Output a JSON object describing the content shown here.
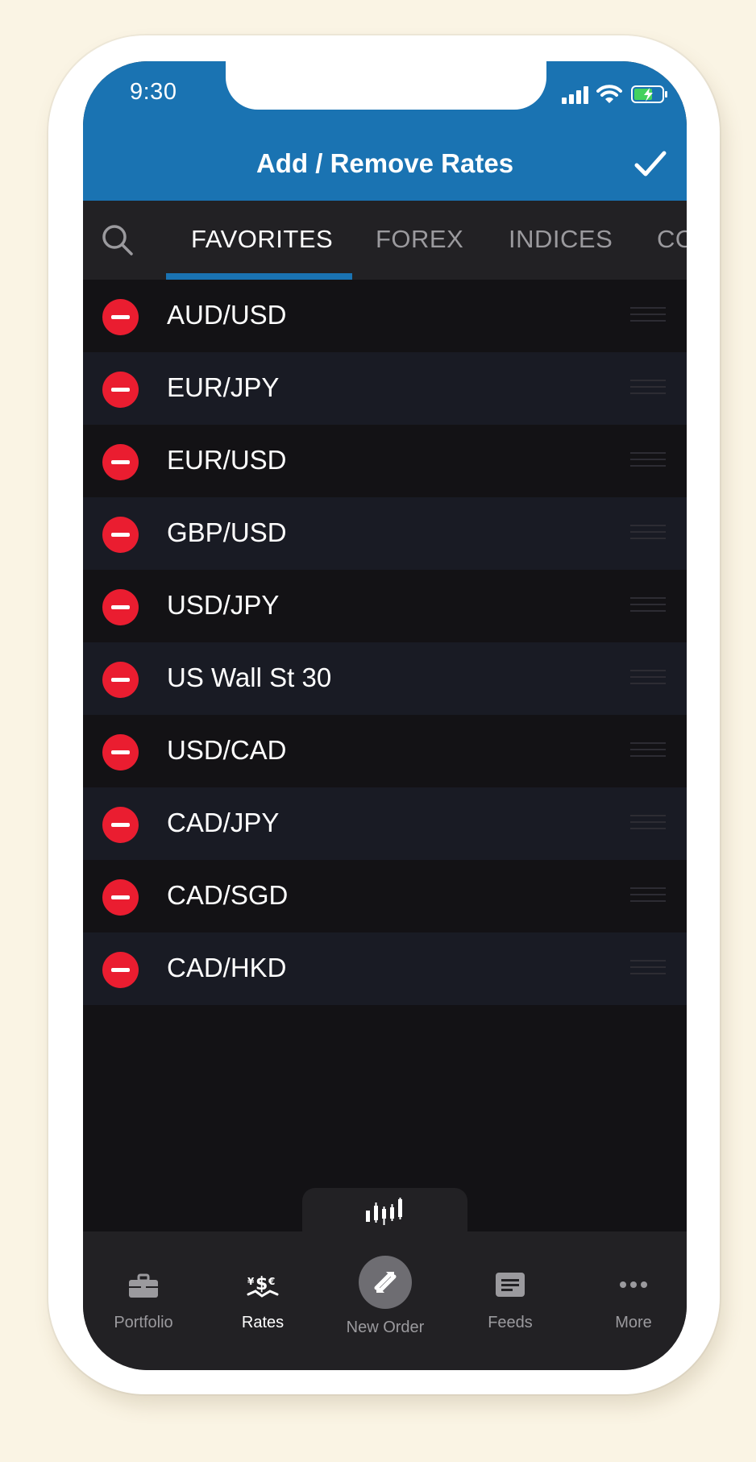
{
  "status_bar": {
    "time": "9:30"
  },
  "header": {
    "title": "Add / Remove Rates"
  },
  "tabs": [
    {
      "label": "FAVORITES",
      "active": true
    },
    {
      "label": "FOREX",
      "active": false
    },
    {
      "label": "INDICES",
      "active": false
    },
    {
      "label": "CO",
      "active": false
    }
  ],
  "rates": [
    "AUD/USD",
    "EUR/JPY",
    "EUR/USD",
    "GBP/USD",
    "USD/JPY",
    "US Wall St 30",
    "USD/CAD",
    "CAD/JPY",
    "CAD/SGD",
    "CAD/HKD"
  ],
  "bottom_nav": {
    "portfolio": "Portfolio",
    "rates": "Rates",
    "new_order": "New Order",
    "feeds": "Feeds",
    "more": "More"
  },
  "colors": {
    "header_blue": "#1a73b2",
    "remove_red": "#ea1d30",
    "background": "#131215",
    "alt_row": "#191b24",
    "bar": "#222124"
  },
  "icons": [
    "search-icon",
    "checkmark-icon",
    "minus-icon",
    "drag-handle-icon",
    "chart-icon",
    "briefcase-icon",
    "currency-icon",
    "swap-icon",
    "feeds-icon",
    "more-icon"
  ]
}
